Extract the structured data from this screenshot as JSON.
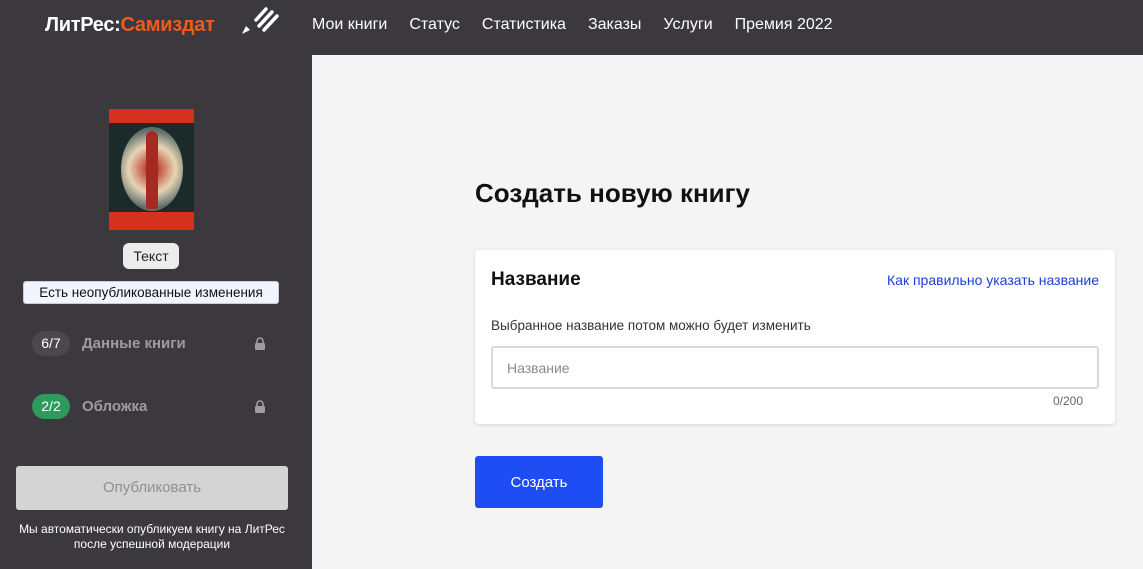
{
  "header": {
    "logo_part1": "ЛитРес:",
    "logo_part2": "Самиздат",
    "nav": [
      "Мои книги",
      "Статус",
      "Статистика",
      "Заказы",
      "Услуги",
      "Премия 2022"
    ]
  },
  "sidebar": {
    "type_label": "Текст",
    "unpublished_notice": "Есть неопубликованные изменения",
    "steps": [
      {
        "badge": "6/7",
        "label": "Данные книги",
        "color": "#4a474d"
      },
      {
        "badge": "2/2",
        "label": "Обложка",
        "color": "#2e9a5e"
      }
    ],
    "publish_label": "Опубликовать",
    "note": "Мы автоматически опубликуем книгу на ЛитРес после успешной модерации"
  },
  "main": {
    "title": "Создать новую книгу",
    "card": {
      "heading": "Название",
      "help_link": "Как правильно указать название",
      "hint": "Выбранное название потом можно будет изменить",
      "input_placeholder": "Название",
      "input_value": "",
      "counter": "0/200"
    },
    "create_label": "Создать"
  }
}
